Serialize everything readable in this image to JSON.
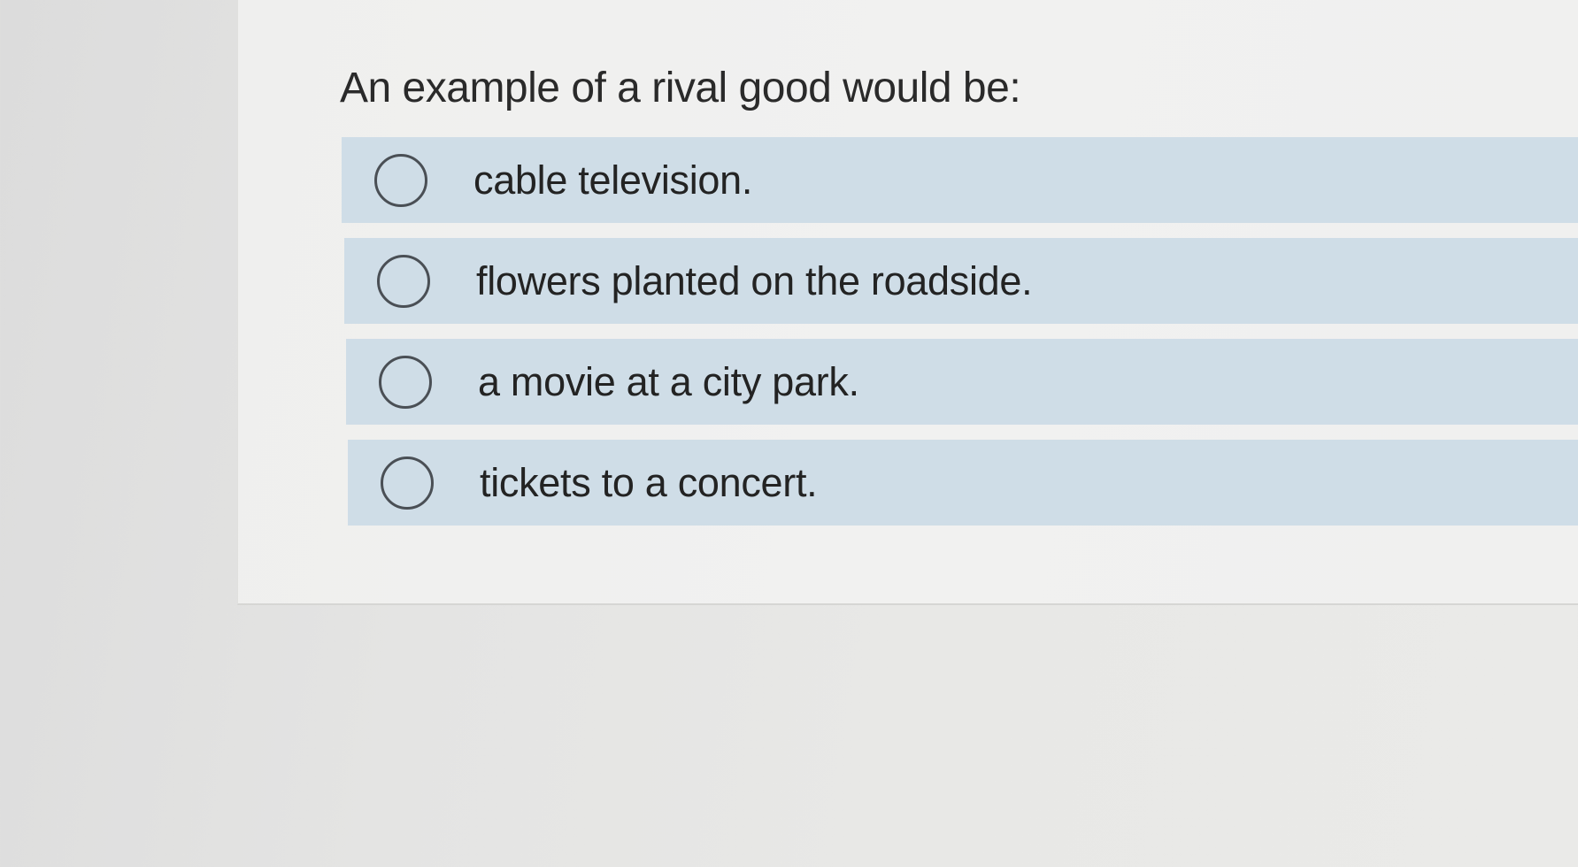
{
  "question": {
    "text": "An example of a rival good would be:"
  },
  "options": [
    {
      "label": "cable television."
    },
    {
      "label": "flowers planted on the roadside."
    },
    {
      "label": "a movie at a city park."
    },
    {
      "label": "tickets to a concert."
    }
  ],
  "colors": {
    "option_background": "#cfdde7",
    "radio_border": "#4a4f55",
    "card_background": "#f0f0ef"
  }
}
